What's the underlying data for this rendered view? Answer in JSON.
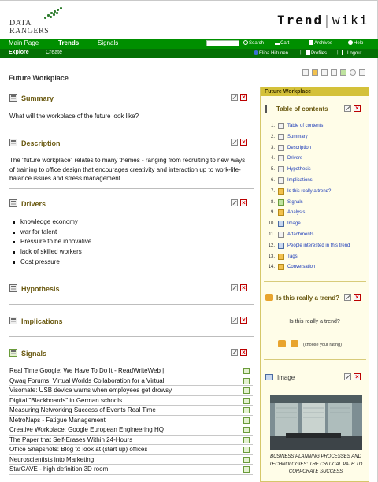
{
  "header": {
    "logo_line1": "DATA",
    "logo_line2": "RANGERS",
    "app_name_a": "Trend",
    "app_name_sep": "|",
    "app_name_b": "wiki"
  },
  "nav": {
    "main": [
      {
        "label": "Main Page"
      },
      {
        "label": "Trends"
      },
      {
        "label": "Signals"
      }
    ],
    "utilities": [
      "Search",
      "Cart",
      "Archives",
      "Help"
    ],
    "sub": [
      {
        "label": "Explore"
      },
      {
        "label": "Create"
      }
    ],
    "user": "Elina Hiltunen",
    "profiles": "Profiles",
    "logout": "Logout"
  },
  "page": {
    "title": "Future Workplace"
  },
  "sections": {
    "summary": {
      "title": "Summary",
      "text": "What will the workplace of the future look like?"
    },
    "description": {
      "title": "Description",
      "text": "The \"future workplace\" relates to many themes - ranging from recruiting to new ways of training to office design that encourages creativity and interaction up to work-life-balance issues and stress management."
    },
    "drivers": {
      "title": "Drivers",
      "items": [
        "knowledge economy",
        "war for talent",
        "Pressure to be innovative",
        "lack of skilled workers",
        "Cost pressure"
      ]
    },
    "hypothesis": {
      "title": "Hypothesis"
    },
    "implications": {
      "title": "Implications"
    },
    "signals": {
      "title": "Signals",
      "items": [
        "Real Time Google: We Have To Do It - ReadWriteWeb |",
        "Qwaq Forums: Virtual Worlds Collaboration for a Virtual",
        "Visomate: USB device warns when employees get drowsy",
        "Digital \"Blackboards\" in German schools",
        "Measuring Networking Success of Events Real Time",
        "MetroNaps - Fatigue Management",
        "Creative Workplace: Google European Engineering HQ",
        "The Paper that Self-Erases Within 24-Hours",
        "Office Snapshots: Blog to look at (start up) offices",
        "Neuroscientists into Marketing",
        "StarCAVE - high definition 3D room"
      ]
    }
  },
  "sidebar": {
    "header": "Future Workplace",
    "toc": {
      "title": "Table of contents",
      "items": [
        {
          "num": "1.",
          "label": "Table of contents"
        },
        {
          "num": "2.",
          "label": "Summary"
        },
        {
          "num": "3.",
          "label": "Description"
        },
        {
          "num": "4.",
          "label": "Drivers"
        },
        {
          "num": "5.",
          "label": "Hypothesis"
        },
        {
          "num": "6.",
          "label": "Implications"
        },
        {
          "num": "7.",
          "label": "Is this really a trend?"
        },
        {
          "num": "8.",
          "label": "Signals"
        },
        {
          "num": "9.",
          "label": "Analysis"
        },
        {
          "num": "10.",
          "label": "Image"
        },
        {
          "num": "11.",
          "label": "Attachments"
        },
        {
          "num": "12.",
          "label": "People interested in this trend"
        },
        {
          "num": "13.",
          "label": "Tags"
        },
        {
          "num": "14.",
          "label": "Conversation"
        }
      ]
    },
    "trend_box": {
      "title": "Is this really a trend?",
      "question": "Is this really a trend?",
      "rating_hint": "(choose your rating)"
    },
    "image_box": {
      "title": "Image",
      "caption": "BUSINESS PLANNING PROCESSES AND TECHNOLOGIES: THE CRITICAL PATH TO CORPORATE SUCCESS"
    }
  }
}
